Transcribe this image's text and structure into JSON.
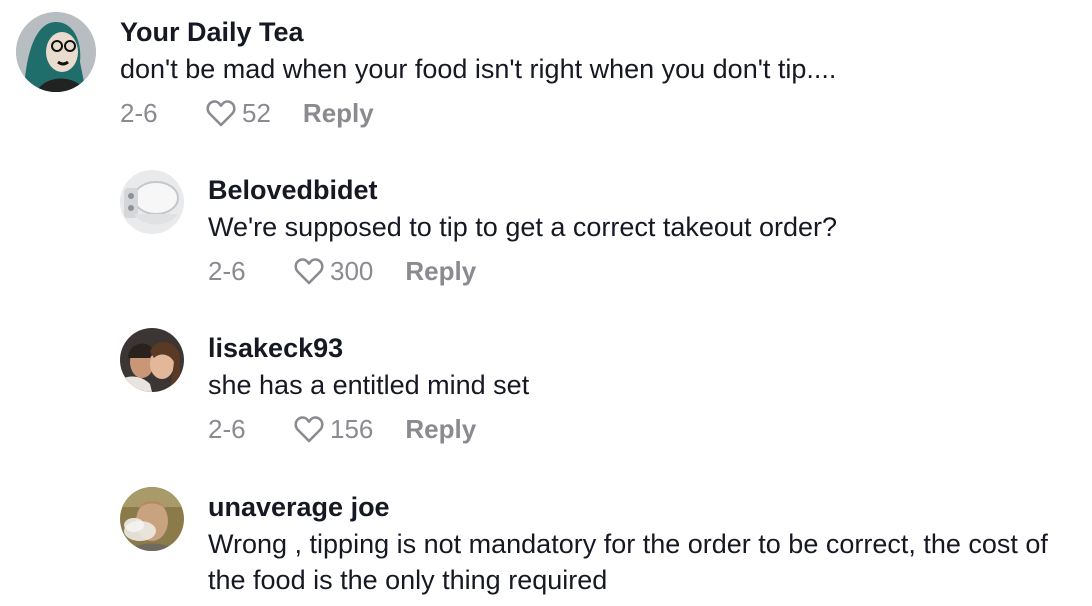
{
  "comments": [
    {
      "username": "Your Daily Tea",
      "text": "don't be mad when your food isn't right when you don't tip....",
      "date": "2-6",
      "likes": "52",
      "reply_label": "Reply"
    },
    {
      "username": "Belovedbidet",
      "text": "We're supposed to tip to get a correct takeout order?",
      "date": "2-6",
      "likes": "300",
      "reply_label": "Reply"
    },
    {
      "username": "lisakeck93",
      "text": "she has a entitled mind set",
      "date": "2-6",
      "likes": "156",
      "reply_label": "Reply"
    },
    {
      "username": "unaverage joe",
      "text": "Wrong , tipping is not mandatory for the order to be correct, the cost of the food is the only thing required"
    }
  ],
  "icons": {
    "like": "heart-outline-icon"
  }
}
